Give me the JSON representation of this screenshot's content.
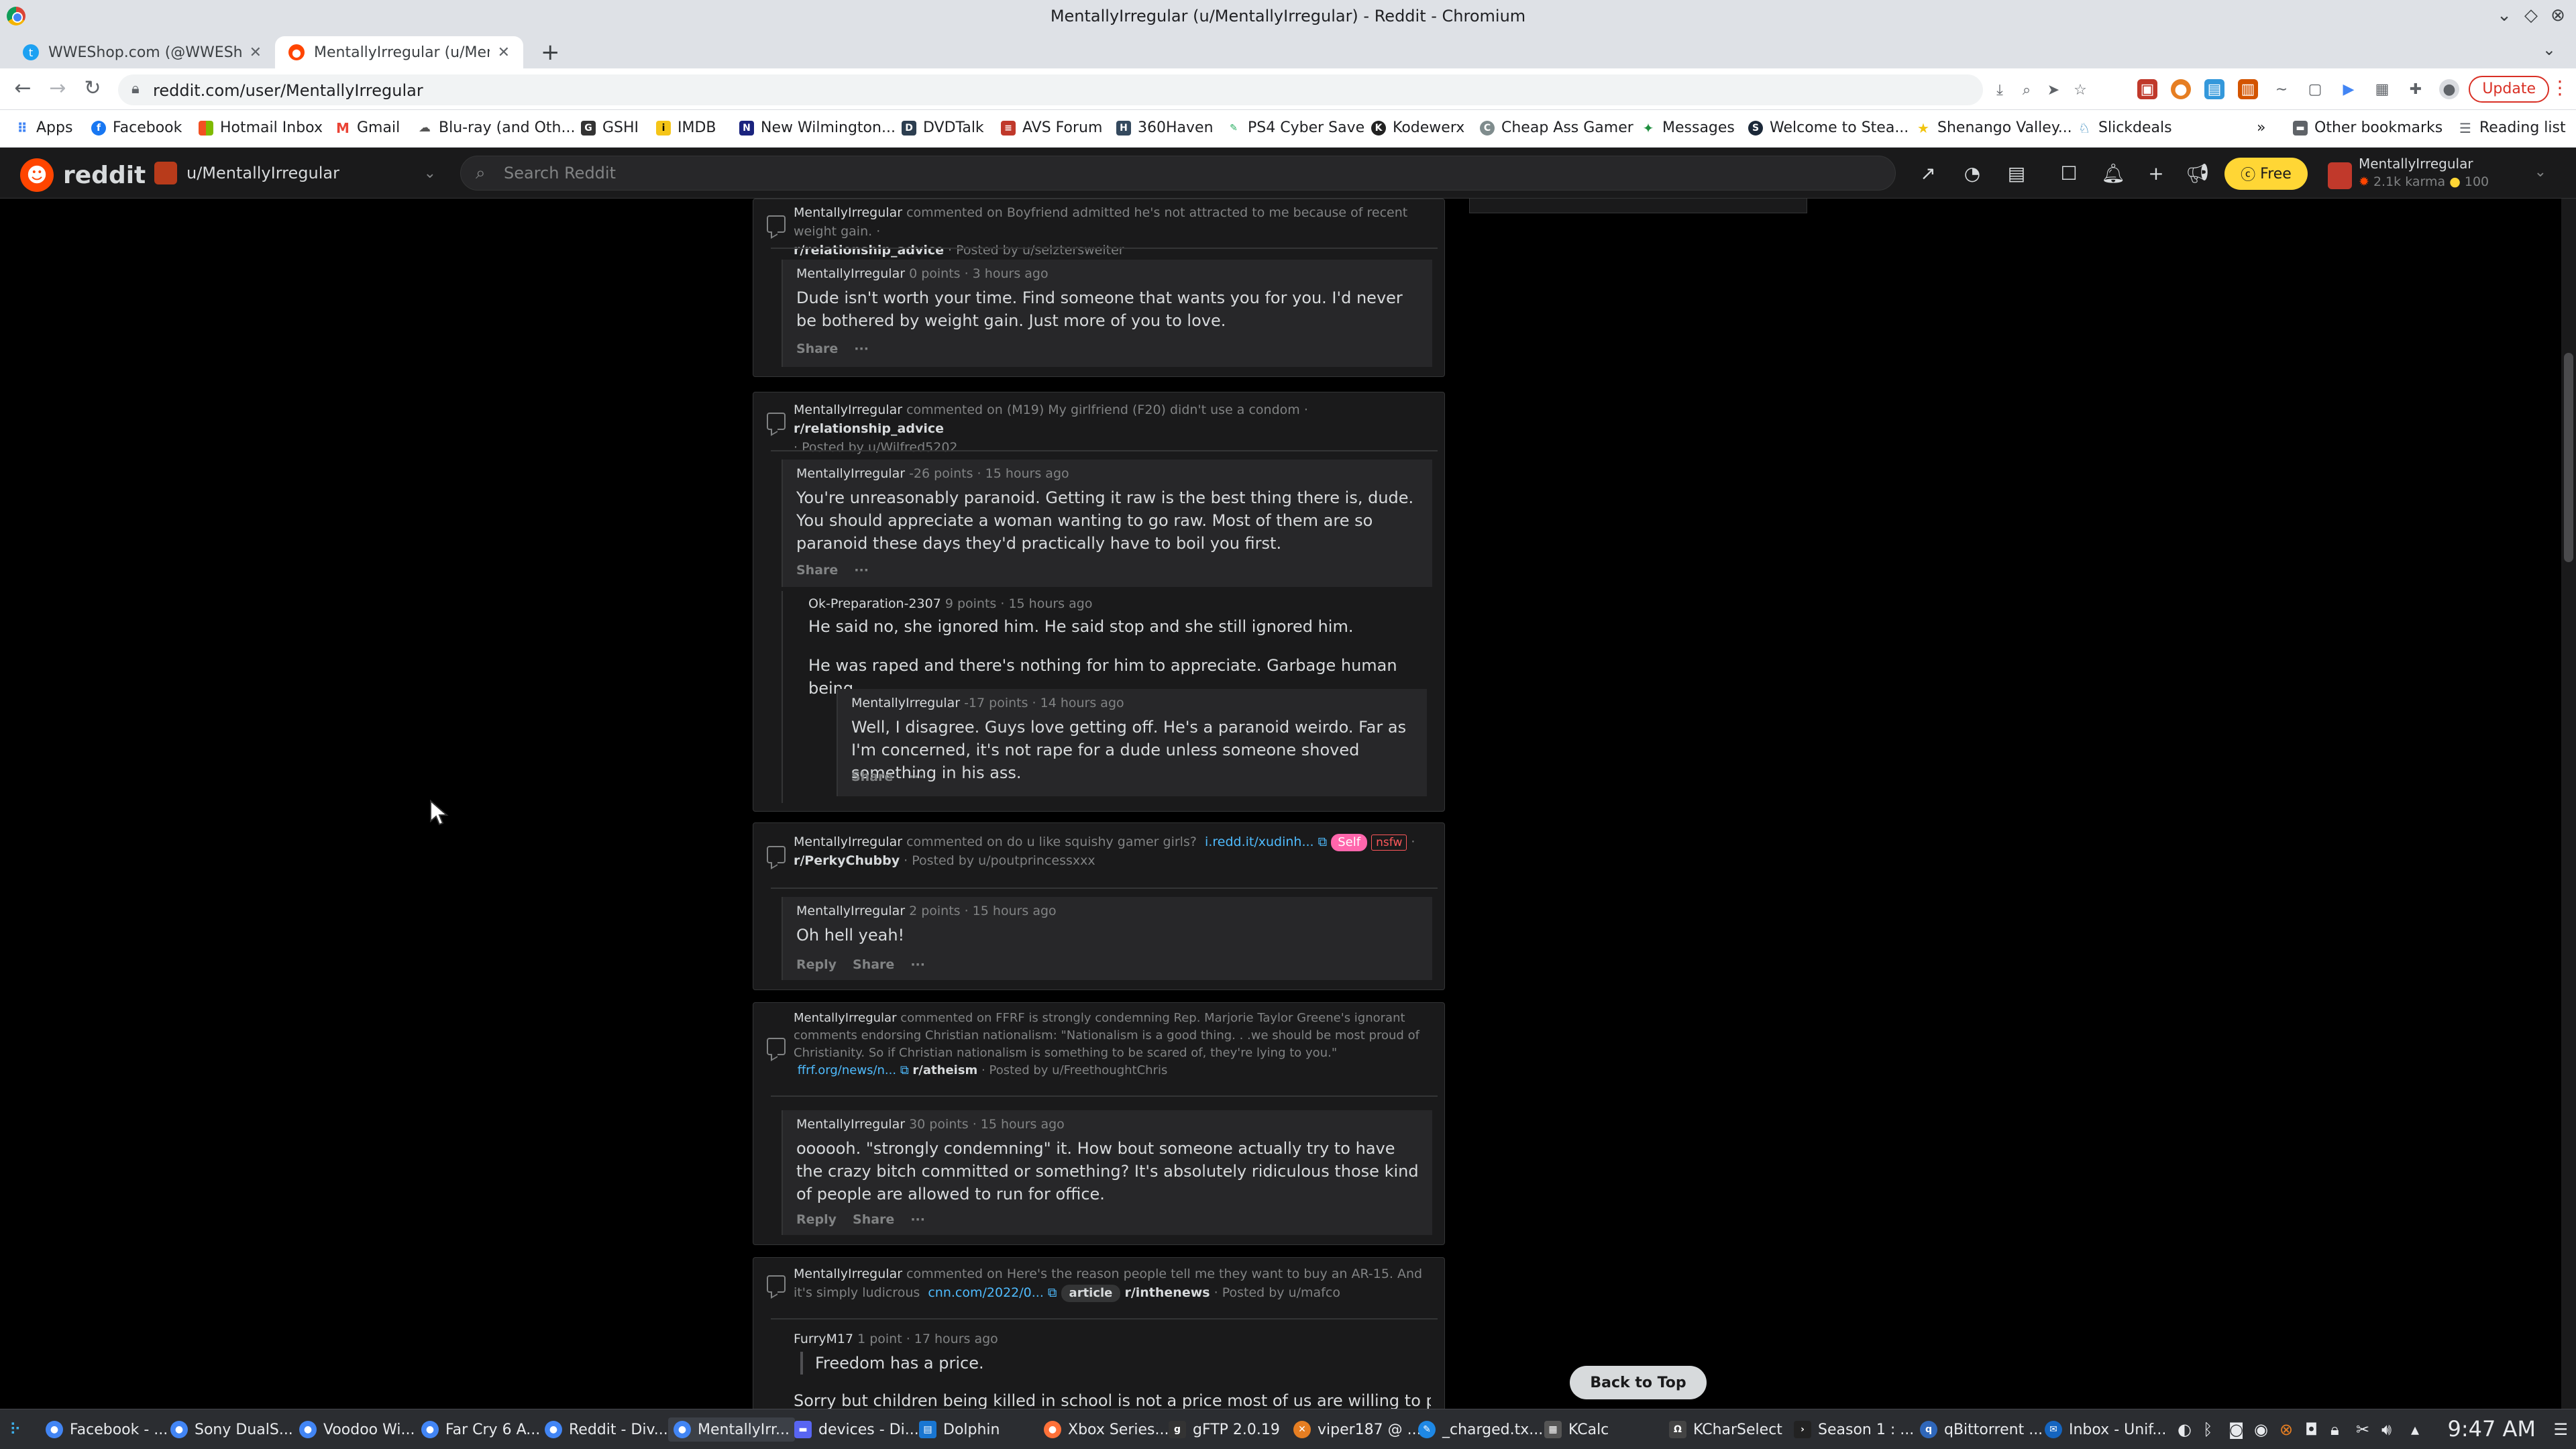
{
  "window": {
    "title": "MentallyIrregular (u/MentallyIrregular) - Reddit - Chromium"
  },
  "tabs": [
    {
      "label": "WWEShop.com (@WWEShop",
      "active": false
    },
    {
      "label": "MentallyIrregular (u/Mentall",
      "active": true
    }
  ],
  "toolbar": {
    "url": "reddit.com/user/MentallyIrregular",
    "update_label": "Update"
  },
  "bookmarks": [
    "Apps",
    "Facebook",
    "Hotmail Inbox",
    "Gmail",
    "Blu-ray (and Oth...",
    "GSHI",
    "IMDB",
    "New Wilmington...",
    "DVDTalk",
    "AVS Forum",
    "360Haven",
    "PS4 Cyber Save",
    "Kodewerx",
    "Cheap Ass Gamer",
    "Messages",
    "Welcome to Stea...",
    "Shenango Valley...",
    "Slickdeals",
    "»",
    "Other bookmarks",
    "Reading list"
  ],
  "reddit": {
    "logo_text": "reddit",
    "community": "u/MentallyIrregular",
    "search_placeholder": "Search Reddit",
    "free_label": "Free",
    "user": {
      "name": "MentallyIrregular",
      "karma": "2.1k karma",
      "coins": "100"
    }
  },
  "posts": [
    {
      "head": {
        "user": "MentallyIrregular",
        "commented_on": "commented on",
        "title": "Boyfriend admitted he's not attracted to me because of recent weight gain.",
        "dash": "·",
        "subreddit": "r/relationship_advice",
        "posted_by": "· Posted by u/selztersweiter"
      },
      "comments": [
        {
          "user": "MentallyIrregular",
          "meta": "0 points · 3 hours ago",
          "body": "Dude isn't worth your time. Find someone that wants you for you. I'd never be bothered by weight gain. Just more of you to love.",
          "actions": [
            "Share",
            "···"
          ]
        }
      ]
    },
    {
      "head": {
        "user": "MentallyIrregular",
        "commented_on": "commented on",
        "title": "(M19) My girlfriend (F20) didn't use a condom",
        "dash": "·",
        "subreddit": "r/relationship_advice",
        "posted_by": "· Posted by u/Wilfred5202"
      },
      "comments": [
        {
          "user": "MentallyIrregular",
          "meta": "-26 points · 15 hours ago",
          "body": "You're unreasonably paranoid. Getting it raw is the best thing there is, dude. You should appreciate a woman wanting to go raw. Most of them are so paranoid these days they'd practically have to boil you first.",
          "actions": [
            "Share",
            "···"
          ]
        },
        {
          "user": "Ok-Preparation-2307",
          "meta": "9 points · 15 hours ago",
          "body": "He said no, she ignored him. He said stop and she still ignored him.",
          "body2": "He was raped and there's nothing for him to appreciate. Garbage human being."
        },
        {
          "user": "MentallyIrregular",
          "meta": "-17 points · 14 hours ago",
          "body": "Well, I disagree. Guys love getting off. He's a paranoid weirdo. Far as I'm concerned, it's not rape for a dude unless someone shoved something in his ass.",
          "actions": [
            "Share",
            "···"
          ]
        }
      ]
    },
    {
      "head": {
        "user": "MentallyIrregular",
        "commented_on": "commented on",
        "title": "do u like squishy gamer girls?",
        "link": "i.redd.it/xudinh...",
        "self_badge": "Self",
        "nsfw_badge": "nsfw",
        "dash": "·",
        "subreddit": "r/PerkyChubby",
        "posted_by": "· Posted by u/poutprincessxxx"
      },
      "comments": [
        {
          "user": "MentallyIrregular",
          "meta": "2 points · 15 hours ago",
          "body": "Oh hell yeah!",
          "actions": [
            "Reply",
            "Share",
            "···"
          ]
        }
      ]
    },
    {
      "head": {
        "user": "MentallyIrregular",
        "commented_on": "commented on",
        "title": "FFRF is strongly condemning Rep. Marjorie Taylor Greene's ignorant comments endorsing Christian nationalism: \"Nationalism is a good thing. . .we should be most proud of Christianity. So if Christian nationalism is something to be scared of, they're lying to you.\"",
        "link": "ffrf.org/news/n...",
        "subreddit": "r/atheism",
        "posted_by": "· Posted by u/FreethoughtChris"
      },
      "comments": [
        {
          "user": "MentallyIrregular",
          "meta": "30 points · 15 hours ago",
          "body": "oooooh. \"strongly condemning\" it. How bout someone actually try to have the crazy bitch committed or something? It's absolutely ridiculous those kind of people are allowed to run for office.",
          "actions": [
            "Reply",
            "Share",
            "···"
          ]
        }
      ]
    },
    {
      "head": {
        "user": "MentallyIrregular",
        "commented_on": "commented on",
        "title": "Here's the reason people tell me they want to buy an AR-15. And it's simply ludicrous",
        "link": "cnn.com/2022/0...",
        "article_badge": "article",
        "subreddit": "r/inthenews",
        "posted_by": "· Posted by u/mafco"
      },
      "comments": [
        {
          "user": "FurryM17",
          "meta": "1 point · 17 hours ago",
          "body": "Freedom has a price.",
          "body2": "Sorry but children being killed in school is not a price most of us are willing to pay."
        }
      ]
    }
  ],
  "back_to_top": "Back to Top",
  "taskbar": {
    "items": [
      "Facebook - ...",
      "Sony DualS...",
      "Voodoo Wi...",
      "Far Cry 6 A...",
      "Reddit - Div...",
      "MentallyIrr...",
      "devices - Di...",
      "Dolphin",
      "Xbox Series...",
      "gFTP 2.0.19",
      "viper187 @ ...",
      "_charged.tx...",
      "KCalc",
      "KCharSelect",
      "Season 1 : ...",
      "qBittorrent ...",
      "Inbox - Unif..."
    ],
    "clock": "9:47 AM"
  },
  "colors": {
    "reddit_orange": "#ff4500",
    "link_blue": "#4fbcff",
    "card_bg": "#1a1a1b",
    "comment_bg": "#272729",
    "nsfw_red": "#ff585b",
    "self_pink": "#ff66ac",
    "free_yellow": "#ffd635"
  }
}
